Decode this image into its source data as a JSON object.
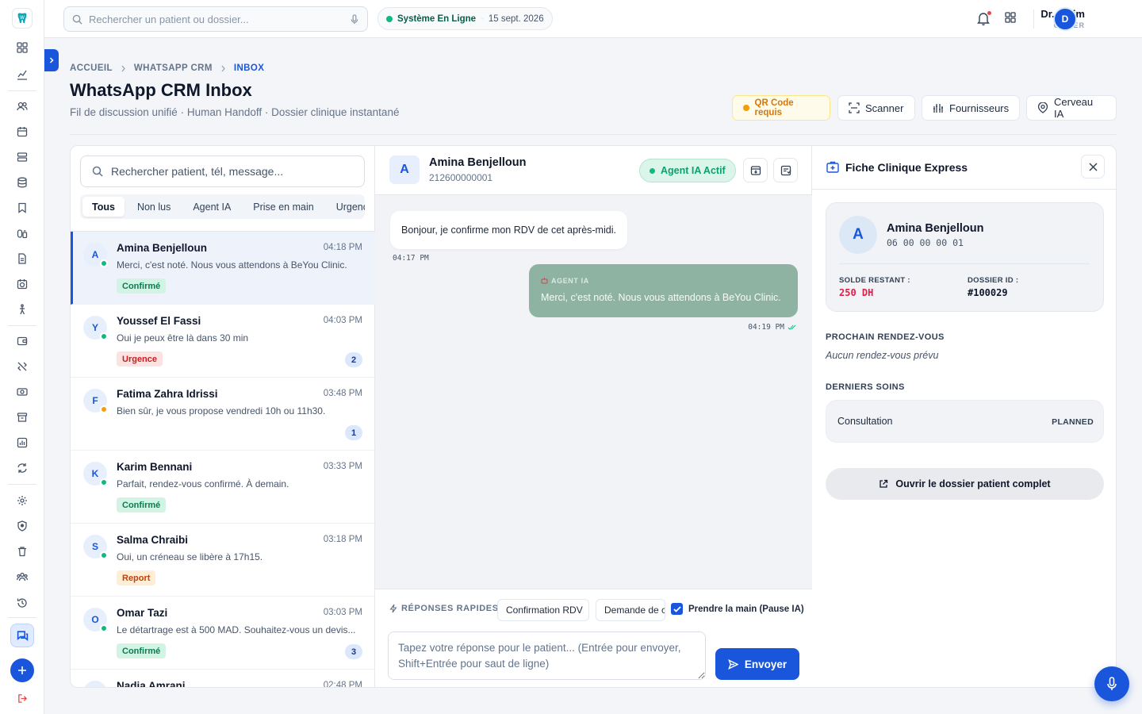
{
  "topbar": {
    "search_placeholder": "Rechercher un patient ou dossier...",
    "system_status": "Système En Ligne",
    "date": "15 sept. 2026",
    "user_name": "Dr. karim",
    "user_role": "OWNER",
    "avatar_initial": "D"
  },
  "breadcrumb": [
    "ACCUEIL",
    "WHATSAPP CRM",
    "INBOX"
  ],
  "page": {
    "title": "WhatsApp CRM Inbox",
    "subtitle": "Fil de discussion unifié · Human Handoff · Dossier clinique instantané"
  },
  "header_actions": {
    "qr": "QR Code requis",
    "scanner": "Scanner",
    "suppliers": "Fournisseurs",
    "brain": "Cerveau IA"
  },
  "inbox": {
    "search_placeholder": "Rechercher patient, tél, message...",
    "filters": [
      "Tous",
      "Non lus",
      "Agent IA",
      "Prise en main",
      "Urgence"
    ],
    "active_filter": "Tous",
    "conversations": [
      {
        "initial": "A",
        "name": "Amina Benjelloun",
        "time": "04:18 PM",
        "message": "Merci, c'est noté. Nous vous attendons à BeYou Clinic.",
        "tag": "Confirmé",
        "tag_type": "ok",
        "status": "green",
        "unread": ""
      },
      {
        "initial": "Y",
        "name": "Youssef El Fassi",
        "time": "04:03 PM",
        "message": "Oui je peux être là dans 30 min",
        "tag": "Urgence",
        "tag_type": "urgent",
        "status": "green",
        "unread": "2"
      },
      {
        "initial": "F",
        "name": "Fatima Zahra Idrissi",
        "time": "03:48 PM",
        "message": "Bien sûr, je vous propose vendredi 10h ou 11h30.",
        "tag": "",
        "tag_type": "",
        "status": "orange",
        "unread": "1"
      },
      {
        "initial": "K",
        "name": "Karim Bennani",
        "time": "03:33 PM",
        "message": "Parfait, rendez-vous confirmé. À demain.",
        "tag": "Confirmé",
        "tag_type": "ok",
        "status": "green",
        "unread": ""
      },
      {
        "initial": "S",
        "name": "Salma Chraibi",
        "time": "03:18 PM",
        "message": "Oui, un créneau se libère à 17h15.",
        "tag": "Report",
        "tag_type": "report",
        "status": "green",
        "unread": ""
      },
      {
        "initial": "O",
        "name": "Omar Tazi",
        "time": "03:03 PM",
        "message": "Le détartrage est à 500 MAD. Souhaitez-vous un devis...",
        "tag": "Confirmé",
        "tag_type": "ok",
        "status": "green",
        "unread": "3"
      },
      {
        "initial": "N",
        "name": "Nadia Amrani",
        "time": "02:48 PM",
        "message": "",
        "tag": "",
        "tag_type": "",
        "status": "green",
        "unread": ""
      }
    ]
  },
  "chat": {
    "initial": "A",
    "name": "Amina Benjelloun",
    "phone": "212600000001",
    "ai_status": "Agent IA Actif",
    "incoming": {
      "text": "Bonjour, je confirme mon RDV de cet après-midi.",
      "time": "04:17 PM"
    },
    "outgoing": {
      "label": "AGENT IA",
      "text": "Merci, c'est noté. Nous vous attendons à BeYou Clinic.",
      "time": "04:19 PM"
    },
    "quick_replies_label": "RÉPONSES RAPIDES",
    "quick_replies": [
      "Confirmation RDV",
      "Demande de c"
    ],
    "takeover_label": "Prendre la main (Pause IA)",
    "takeover_checked": true,
    "reply_placeholder": "Tapez votre réponse pour le patient... (Entrée pour envoyer, Shift+Entrée pour saut de ligne)",
    "send_label": "Envoyer"
  },
  "clinic": {
    "title": "Fiche Clinique Express",
    "initial": "A",
    "name": "Amina Benjelloun",
    "phone": "06 00 00 00 01",
    "balance_label": "SOLDE RESTANT :",
    "balance_value": "250 DH",
    "file_id_label": "DOSSIER ID :",
    "file_id_value": "#100029",
    "next_rdv_label": "PROCHAIN RENDEZ-VOUS",
    "next_rdv_value": "Aucun rendez-vous prévu",
    "last_care_label": "DERNIERS SOINS",
    "care_name": "Consultation",
    "care_status": "PLANNED",
    "open_file": "Ouvrir le dossier patient complet"
  },
  "colors": {
    "primary": "#1a56db",
    "success": "#10b981",
    "danger": "#ef4444",
    "warning": "#f59e0b",
    "ai_bubble": "#8fb3a3"
  }
}
